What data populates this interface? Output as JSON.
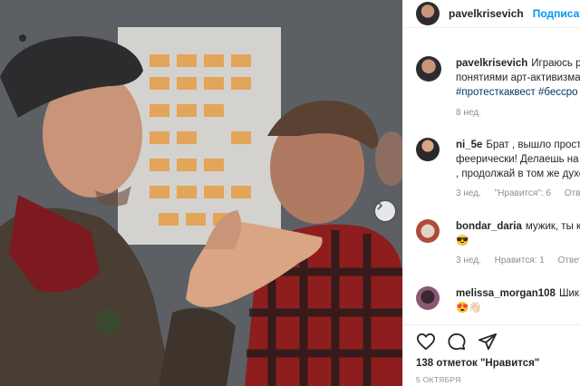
{
  "post_header": {
    "username": "pavelkrisevich",
    "follow_label": "Подписат"
  },
  "caption": {
    "username": "pavelkrisevich",
    "line1": "Играюсь ру",
    "line2": "понятиями арт-активизма",
    "tags": "#протесткаквест #бессро",
    "time": "8 нед."
  },
  "comments": [
    {
      "username": "ni_5e",
      "lines": [
        "Брат , вышло просто",
        "феерически! Делаешь на",
        ", продолжай в том же духе"
      ],
      "time": "3 нед.",
      "likes": "\"Нравится\": 6",
      "reply": "Ответить"
    },
    {
      "username": "bondar_daria",
      "lines": [
        "мужик, ты кр",
        "😎"
      ],
      "time": "3 нед.",
      "likes": "Нравится: 1",
      "reply": "Ответить"
    },
    {
      "username": "melissa_morgan108",
      "lines": [
        "Шикар",
        "😍👋🏻"
      ]
    }
  ],
  "actions": {
    "likes": "138 отметок \"Нравится\"",
    "date": "5 ОКТЯБРЯ"
  },
  "icons": [
    "heart-icon",
    "comment-icon",
    "share-icon",
    "chevron-right-icon"
  ]
}
